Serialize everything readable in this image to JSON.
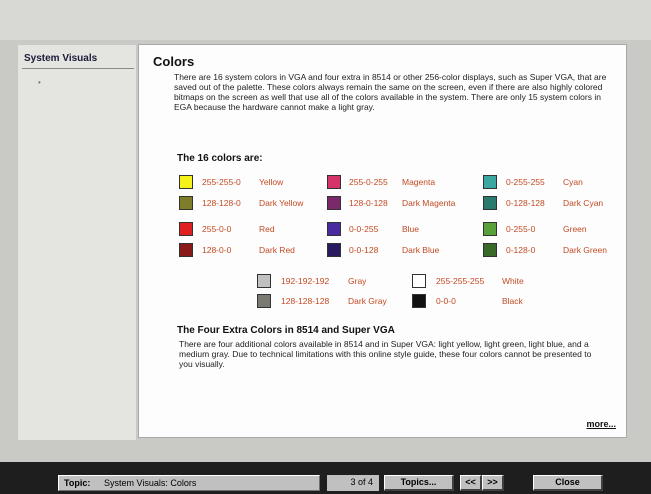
{
  "sidebar": {
    "title": "System Visuals"
  },
  "panel": {
    "title": "Colors",
    "intro": "There are 16 system colors in VGA and four extra in 8514 or other 256-color displays, such as Super VGA, that are saved out of the palette. These colors always remain the same on the screen, even if there are also highly colored bitmaps on the screen as well that use all of the colors available in the system. There are only 15 system colors in EGA because the hardware cannot make a light gray.",
    "colors_heading": "The 16 colors are:",
    "colors": [
      {
        "value": "255-255-0",
        "name": "Yellow",
        "hex": "#f5f21a"
      },
      {
        "value": "128-128-0",
        "name": "Dark Yellow",
        "hex": "#7d7d2a"
      },
      {
        "value": "255-0-0",
        "name": "Red",
        "hex": "#e02020"
      },
      {
        "value": "128-0-0",
        "name": "Dark Red",
        "hex": "#8a1a1a"
      },
      {
        "value": "255-0-255",
        "name": "Magenta",
        "hex": "#d6336a"
      },
      {
        "value": "128-0-128",
        "name": "Dark Magenta",
        "hex": "#7a2a6a"
      },
      {
        "value": "0-0-255",
        "name": "Blue",
        "hex": "#4a2aa0"
      },
      {
        "value": "0-0-128",
        "name": "Dark Blue",
        "hex": "#2a1a60"
      },
      {
        "value": "0-255-255",
        "name": "Cyan",
        "hex": "#3aa8a0"
      },
      {
        "value": "0-128-128",
        "name": "Dark Cyan",
        "hex": "#2a7a70"
      },
      {
        "value": "0-255-0",
        "name": "Green",
        "hex": "#5aa03a"
      },
      {
        "value": "0-128-0",
        "name": "Dark Green",
        "hex": "#3a6a2a"
      },
      {
        "value": "192-192-192",
        "name": "Gray",
        "hex": "#c0c0c0"
      },
      {
        "value": "128-128-128",
        "name": "Dark Gray",
        "hex": "#7a7a72"
      },
      {
        "value": "255-255-255",
        "name": "White",
        "hex": "#ffffff"
      },
      {
        "value": "0-0-0",
        "name": "Black",
        "hex": "#111111"
      }
    ],
    "extra_heading": "The Four Extra Colors in 8514 and Super VGA",
    "extra_text": "There are four additional colors available in 8514 and in Super VGA: light yellow, light green, light blue, and a medium gray. Due to technical limitations with this online style guide, these four colors cannot be presented to you visually.",
    "more_link": "more..."
  },
  "footer": {
    "topic_label": "Topic:",
    "topic_value": "System Visuals: Colors",
    "page_count": "3 of 4",
    "topics_button": "Topics...",
    "prev_button": "<<",
    "next_button": ">>",
    "close_button": "Close"
  }
}
